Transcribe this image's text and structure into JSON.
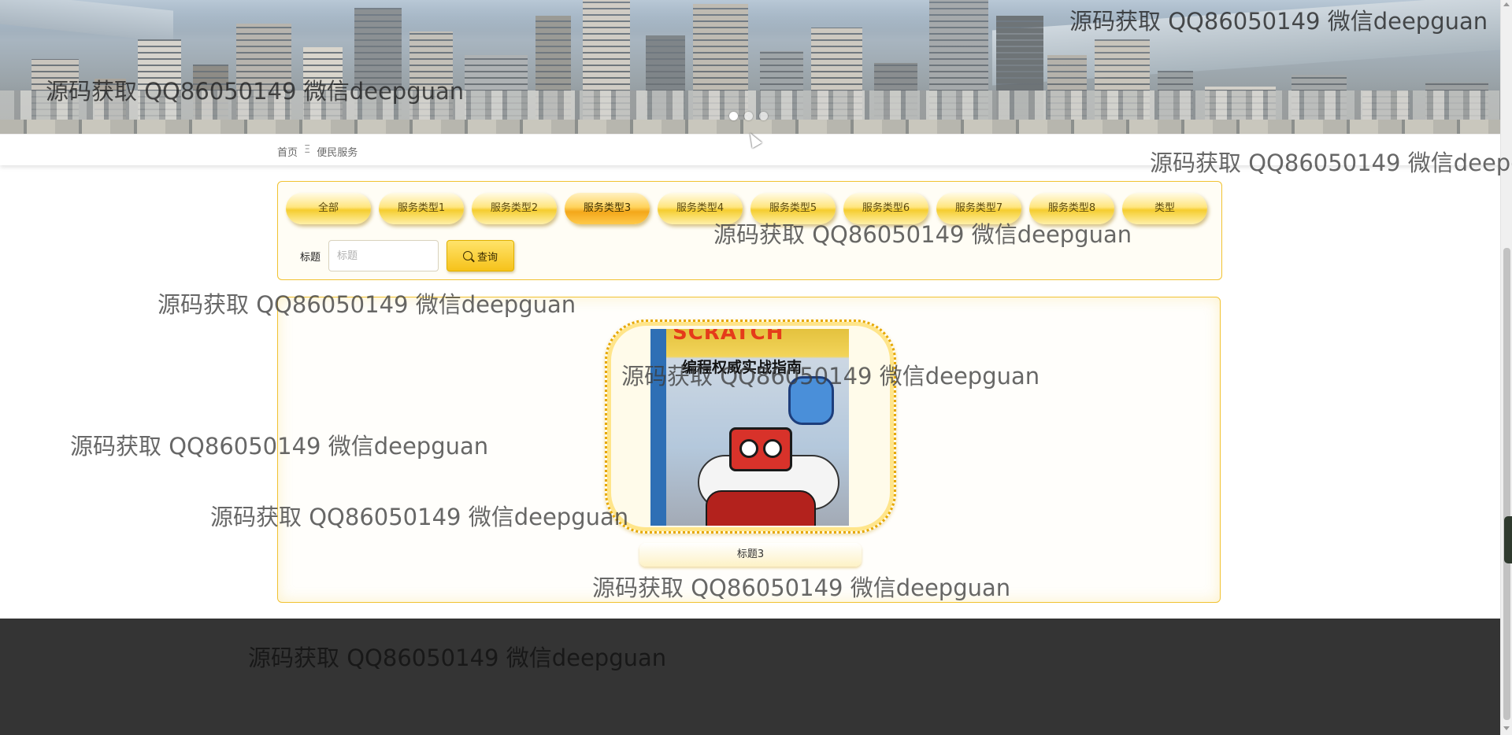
{
  "breadcrumb": {
    "home": "首页",
    "separator": "Ξ",
    "current": "便民服务"
  },
  "carousel": {
    "slide_count": 3,
    "active_index": 0
  },
  "filter": {
    "types": [
      "全部",
      "服务类型1",
      "服务类型2",
      "服务类型3",
      "服务类型4",
      "服务类型5",
      "服务类型6",
      "服务类型7",
      "服务类型8",
      "类型"
    ],
    "active_type": "服务类型3",
    "search_label": "标题",
    "search_placeholder": "标题",
    "search_value": "",
    "search_button": "查询"
  },
  "list": {
    "items": [
      {
        "title": "标题3",
        "cover_text_top": "SCRATCH",
        "cover_text_title": "编程权威实战指南"
      }
    ]
  },
  "watermark_text": "源码获取 QQ86050149 微信deepguan",
  "colors": {
    "accent": "#f5cd2f",
    "border": "#f1c232",
    "footer": "#343434"
  }
}
